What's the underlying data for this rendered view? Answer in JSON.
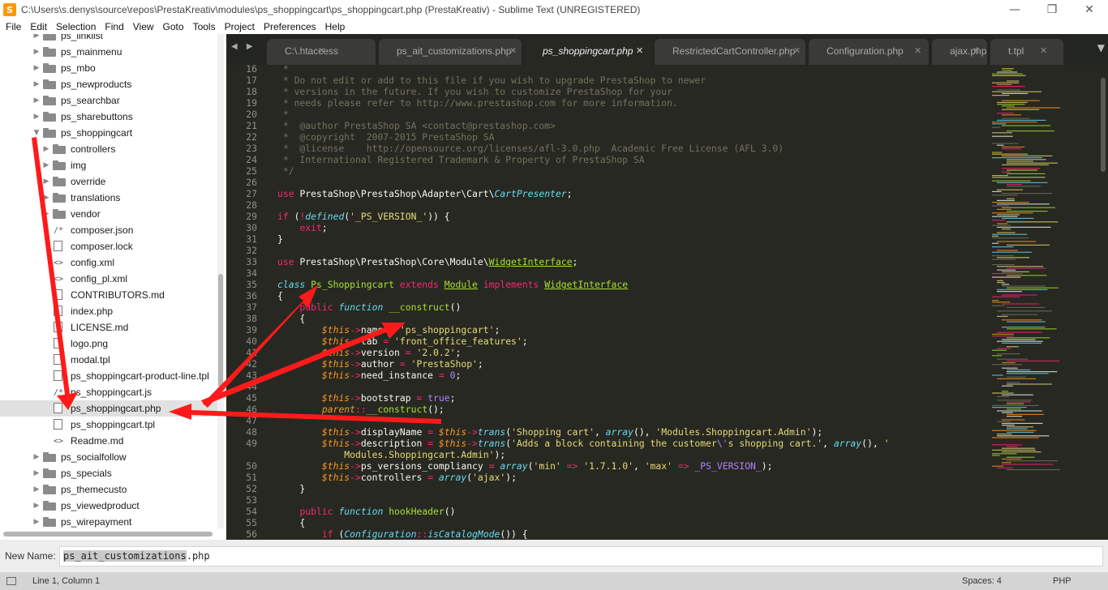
{
  "window": {
    "title": "C:\\Users\\s.denys\\source\\repos\\PrestaKreativ\\modules\\ps_shoppingcart\\ps_shoppingcart.php (PrestaKreativ) - Sublime Text (UNREGISTERED)",
    "app_icon_letter": "S",
    "minimize_glyph": "—",
    "restore_glyph": "❐",
    "close_glyph": "✕"
  },
  "menu": [
    "File",
    "Edit",
    "Selection",
    "Find",
    "View",
    "Goto",
    "Tools",
    "Project",
    "Preferences",
    "Help"
  ],
  "sidebar": {
    "items": [
      {
        "label": "ps_linklist",
        "kind": "folder",
        "depth": 0,
        "expanded": false
      },
      {
        "label": "ps_mainmenu",
        "kind": "folder",
        "depth": 0,
        "expanded": false
      },
      {
        "label": "ps_mbo",
        "kind": "folder",
        "depth": 0,
        "expanded": false
      },
      {
        "label": "ps_newproducts",
        "kind": "folder",
        "depth": 0,
        "expanded": false
      },
      {
        "label": "ps_searchbar",
        "kind": "folder",
        "depth": 0,
        "expanded": false
      },
      {
        "label": "ps_sharebuttons",
        "kind": "folder",
        "depth": 0,
        "expanded": false
      },
      {
        "label": "ps_shoppingcart",
        "kind": "folder",
        "depth": 0,
        "expanded": true
      },
      {
        "label": "controllers",
        "kind": "folder",
        "depth": 1,
        "expanded": false
      },
      {
        "label": "img",
        "kind": "folder",
        "depth": 1,
        "expanded": false
      },
      {
        "label": "override",
        "kind": "folder",
        "depth": 1,
        "expanded": false
      },
      {
        "label": "translations",
        "kind": "folder",
        "depth": 1,
        "expanded": false
      },
      {
        "label": "vendor",
        "kind": "folder",
        "depth": 1,
        "expanded": false
      },
      {
        "label": "composer.json",
        "kind": "file",
        "icon": "/*",
        "depth": 1
      },
      {
        "label": "composer.lock",
        "kind": "file",
        "icon": "doc",
        "depth": 1
      },
      {
        "label": "config.xml",
        "kind": "file",
        "icon": "<>",
        "depth": 1
      },
      {
        "label": "config_pl.xml",
        "kind": "file",
        "icon": "<>",
        "depth": 1
      },
      {
        "label": "CONTRIBUTORS.md",
        "kind": "file",
        "icon": "doc",
        "depth": 1
      },
      {
        "label": "index.php",
        "kind": "file",
        "icon": "doc",
        "depth": 1
      },
      {
        "label": "LICENSE.md",
        "kind": "file",
        "icon": "doc",
        "depth": 1
      },
      {
        "label": "logo.png",
        "kind": "file",
        "icon": "doc",
        "depth": 1
      },
      {
        "label": "modal.tpl",
        "kind": "file",
        "icon": "doc",
        "depth": 1
      },
      {
        "label": "ps_shoppingcart-product-line.tpl",
        "kind": "file",
        "icon": "doc",
        "depth": 1
      },
      {
        "label": "ps_shoppingcart.js",
        "kind": "file",
        "icon": "/*",
        "depth": 1
      },
      {
        "label": "ps_shoppingcart.php",
        "kind": "file",
        "icon": "doc",
        "depth": 1,
        "selected": true
      },
      {
        "label": "ps_shoppingcart.tpl",
        "kind": "file",
        "icon": "doc",
        "depth": 1
      },
      {
        "label": "Readme.md",
        "kind": "file",
        "icon": "<>",
        "depth": 1
      },
      {
        "label": "ps_socialfollow",
        "kind": "folder",
        "depth": 0,
        "expanded": false
      },
      {
        "label": "ps_specials",
        "kind": "folder",
        "depth": 0,
        "expanded": false
      },
      {
        "label": "ps_themecusto",
        "kind": "folder",
        "depth": 0,
        "expanded": false
      },
      {
        "label": "ps_viewedproduct",
        "kind": "folder",
        "depth": 0,
        "expanded": false
      },
      {
        "label": "ps_wirepayment",
        "kind": "folder",
        "depth": 0,
        "expanded": false
      }
    ]
  },
  "tabs": {
    "nav_arrows": "◀ ▶",
    "more_glyph": "▼",
    "items": [
      {
        "label": "C:\\.htaccess",
        "active": false
      },
      {
        "label": "ps_ait_customizations.php",
        "active": false
      },
      {
        "label": "ps_shoppingcart.php",
        "active": true
      },
      {
        "label": "RestrictedCartController.php",
        "active": false
      },
      {
        "label": "Configuration.php",
        "active": false
      },
      {
        "label": "ajax.php",
        "active": false
      },
      {
        "label": "t.tpl",
        "active": false
      }
    ],
    "close_glyph": "✕"
  },
  "editor": {
    "lines": [
      {
        "n": "16",
        "tokens": [
          [
            "c",
            " *"
          ]
        ]
      },
      {
        "n": "17",
        "tokens": [
          [
            "c",
            " * Do not edit or add to this file if you wish to upgrade PrestaShop to newer"
          ]
        ]
      },
      {
        "n": "18",
        "tokens": [
          [
            "c",
            " * versions in the future. If you wish to customize PrestaShop for your"
          ]
        ]
      },
      {
        "n": "19",
        "tokens": [
          [
            "c",
            " * needs please refer to http://www.prestashop.com for more information."
          ]
        ]
      },
      {
        "n": "20",
        "tokens": [
          [
            "c",
            " *"
          ]
        ]
      },
      {
        "n": "21",
        "tokens": [
          [
            "c",
            " *  @author PrestaShop SA <contact@prestashop.com>"
          ]
        ]
      },
      {
        "n": "22",
        "tokens": [
          [
            "c",
            " *  @copyright  2007-2015 PrestaShop SA"
          ]
        ]
      },
      {
        "n": "23",
        "tokens": [
          [
            "c",
            " *  @license    http://opensource.org/licenses/afl-3.0.php  Academic Free License (AFL 3.0)"
          ]
        ]
      },
      {
        "n": "24",
        "tokens": [
          [
            "c",
            " *  International Registered Trademark & Property of PrestaShop SA"
          ]
        ]
      },
      {
        "n": "25",
        "tokens": [
          [
            "c",
            " */"
          ]
        ]
      },
      {
        "n": "26",
        "tokens": []
      },
      {
        "n": "27",
        "tokens": [
          [
            "k",
            "use "
          ],
          [
            "p",
            "PrestaShop\\PrestaShop\\Adapter\\Cart\\"
          ],
          [
            "i",
            "CartPresenter"
          ],
          [
            "p",
            ";"
          ]
        ]
      },
      {
        "n": "28",
        "tokens": []
      },
      {
        "n": "29",
        "tokens": [
          [
            "k",
            "if "
          ],
          [
            "p",
            "("
          ],
          [
            "k",
            "!"
          ],
          [
            "i",
            "defined"
          ],
          [
            "p",
            "("
          ],
          [
            "s",
            "'_PS_VERSION_'"
          ],
          [
            "p",
            ")) {"
          ]
        ]
      },
      {
        "n": "30",
        "tokens": [
          [
            "p",
            "    "
          ],
          [
            "k",
            "exit"
          ],
          [
            "p",
            ";"
          ]
        ]
      },
      {
        "n": "31",
        "tokens": [
          [
            "p",
            "}"
          ]
        ]
      },
      {
        "n": "32",
        "tokens": []
      },
      {
        "n": "33",
        "tokens": [
          [
            "k",
            "use "
          ],
          [
            "p",
            "PrestaShop\\PrestaShop\\Core\\Module\\"
          ],
          [
            "cls",
            "WidgetInterface"
          ],
          [
            "p",
            ";"
          ]
        ]
      },
      {
        "n": "34",
        "tokens": []
      },
      {
        "n": "35",
        "tokens": [
          [
            "i",
            "class "
          ],
          [
            "f",
            "Ps_Shoppingcart "
          ],
          [
            "k",
            "extends "
          ],
          [
            "cls",
            "Module"
          ],
          [
            "k",
            " implements "
          ],
          [
            "cls",
            "WidgetInterface"
          ]
        ]
      },
      {
        "n": "36",
        "tokens": [
          [
            "p",
            "{"
          ]
        ]
      },
      {
        "n": "37",
        "tokens": [
          [
            "p",
            "    "
          ],
          [
            "k",
            "public "
          ],
          [
            "i",
            "function "
          ],
          [
            "f",
            "__construct"
          ],
          [
            "p",
            "()"
          ]
        ]
      },
      {
        "n": "38",
        "tokens": [
          [
            "p",
            "    {"
          ]
        ]
      },
      {
        "n": "39",
        "tokens": [
          [
            "p",
            "        "
          ],
          [
            "v",
            "$this"
          ],
          [
            "k",
            "->"
          ],
          [
            "p",
            "name "
          ],
          [
            "k",
            "= "
          ],
          [
            "s",
            "'ps_shoppingcart'"
          ],
          [
            "p",
            ";"
          ]
        ]
      },
      {
        "n": "40",
        "tokens": [
          [
            "p",
            "        "
          ],
          [
            "v",
            "$this"
          ],
          [
            "k",
            "->"
          ],
          [
            "p",
            "tab "
          ],
          [
            "k",
            "= "
          ],
          [
            "s",
            "'front_office_features'"
          ],
          [
            "p",
            ";"
          ]
        ]
      },
      {
        "n": "41",
        "tokens": [
          [
            "p",
            "        "
          ],
          [
            "v",
            "$this"
          ],
          [
            "k",
            "->"
          ],
          [
            "p",
            "version "
          ],
          [
            "k",
            "= "
          ],
          [
            "s",
            "'2.0.2'"
          ],
          [
            "p",
            ";"
          ]
        ]
      },
      {
        "n": "42",
        "tokens": [
          [
            "p",
            "        "
          ],
          [
            "v",
            "$this"
          ],
          [
            "k",
            "->"
          ],
          [
            "p",
            "author "
          ],
          [
            "k",
            "= "
          ],
          [
            "s",
            "'PrestaShop'"
          ],
          [
            "p",
            ";"
          ]
        ]
      },
      {
        "n": "43",
        "tokens": [
          [
            "p",
            "        "
          ],
          [
            "v",
            "$this"
          ],
          [
            "k",
            "->"
          ],
          [
            "p",
            "need_instance "
          ],
          [
            "k",
            "= "
          ],
          [
            "con",
            "0"
          ],
          [
            "p",
            ";"
          ]
        ]
      },
      {
        "n": "44",
        "tokens": []
      },
      {
        "n": "45",
        "tokens": [
          [
            "p",
            "        "
          ],
          [
            "v",
            "$this"
          ],
          [
            "k",
            "->"
          ],
          [
            "p",
            "bootstrap "
          ],
          [
            "k",
            "= "
          ],
          [
            "con",
            "true"
          ],
          [
            "p",
            ";"
          ]
        ]
      },
      {
        "n": "46",
        "tokens": [
          [
            "p",
            "        "
          ],
          [
            "v",
            "parent"
          ],
          [
            "k",
            "::"
          ],
          [
            "f",
            "__construct"
          ],
          [
            "p",
            "();"
          ]
        ]
      },
      {
        "n": "47",
        "tokens": []
      },
      {
        "n": "48",
        "tokens": [
          [
            "p",
            "        "
          ],
          [
            "v",
            "$this"
          ],
          [
            "k",
            "->"
          ],
          [
            "p",
            "displayName "
          ],
          [
            "k",
            "= "
          ],
          [
            "v",
            "$this"
          ],
          [
            "k",
            "->"
          ],
          [
            "i",
            "trans"
          ],
          [
            "p",
            "("
          ],
          [
            "s",
            "'Shopping cart'"
          ],
          [
            "p",
            ", "
          ],
          [
            "i",
            "array"
          ],
          [
            "p",
            "(), "
          ],
          [
            "s",
            "'Modules.Shoppingcart.Admin'"
          ],
          [
            "p",
            ");"
          ]
        ]
      },
      {
        "n": "49",
        "tokens": [
          [
            "p",
            "        "
          ],
          [
            "v",
            "$this"
          ],
          [
            "k",
            "->"
          ],
          [
            "p",
            "description "
          ],
          [
            "k",
            "= "
          ],
          [
            "v",
            "$this"
          ],
          [
            "k",
            "->"
          ],
          [
            "i",
            "trans"
          ],
          [
            "p",
            "("
          ],
          [
            "s",
            "'Adds a block containing the customer"
          ],
          [
            "con",
            "\\'"
          ],
          [
            "s",
            "s shopping cart.'"
          ],
          [
            "p",
            ", "
          ],
          [
            "i",
            "array"
          ],
          [
            "p",
            "(), "
          ],
          [
            "s",
            "'"
          ]
        ]
      },
      {
        "n": "",
        "tokens": [
          [
            "s",
            "            Modules.Shoppingcart.Admin'"
          ],
          [
            "p",
            ");"
          ]
        ]
      },
      {
        "n": "50",
        "tokens": [
          [
            "p",
            "        "
          ],
          [
            "v",
            "$this"
          ],
          [
            "k",
            "->"
          ],
          [
            "p",
            "ps_versions_compliancy "
          ],
          [
            "k",
            "= "
          ],
          [
            "i",
            "array"
          ],
          [
            "p",
            "("
          ],
          [
            "s",
            "'min'"
          ],
          [
            "k",
            " => "
          ],
          [
            "s",
            "'1.7.1.0'"
          ],
          [
            "p",
            ", "
          ],
          [
            "s",
            "'max'"
          ],
          [
            "k",
            " => "
          ],
          [
            "con",
            "_PS_VERSION_"
          ],
          [
            "p",
            ");"
          ]
        ]
      },
      {
        "n": "51",
        "tokens": [
          [
            "p",
            "        "
          ],
          [
            "v",
            "$this"
          ],
          [
            "k",
            "->"
          ],
          [
            "p",
            "controllers "
          ],
          [
            "k",
            "= "
          ],
          [
            "i",
            "array"
          ],
          [
            "p",
            "("
          ],
          [
            "s",
            "'ajax'"
          ],
          [
            "p",
            ");"
          ]
        ]
      },
      {
        "n": "52",
        "tokens": [
          [
            "p",
            "    }"
          ]
        ]
      },
      {
        "n": "53",
        "tokens": []
      },
      {
        "n": "54",
        "tokens": [
          [
            "p",
            "    "
          ],
          [
            "k",
            "public "
          ],
          [
            "i",
            "function "
          ],
          [
            "f",
            "hookHeader"
          ],
          [
            "p",
            "()"
          ]
        ]
      },
      {
        "n": "55",
        "tokens": [
          [
            "p",
            "    {"
          ]
        ]
      },
      {
        "n": "56",
        "tokens": [
          [
            "p",
            "        "
          ],
          [
            "k",
            "if "
          ],
          [
            "p",
            "("
          ],
          [
            "i",
            "Configuration"
          ],
          [
            "k",
            "::"
          ],
          [
            "i",
            "isCatalogMode"
          ],
          [
            "p",
            "()) {"
          ]
        ]
      }
    ]
  },
  "input_panel": {
    "label": "New Name:",
    "value_selected": "ps_ait_customizations",
    "value_rest": ".php"
  },
  "status_bar": {
    "position": "Line 1, Column 1",
    "indentation": "Spaces: 4",
    "syntax": "PHP"
  },
  "colors": {
    "editor_bg": "#272822",
    "tabbar_bg": "#232522",
    "arrow": "#ff1a1a",
    "selection": "#e1e1e1"
  }
}
